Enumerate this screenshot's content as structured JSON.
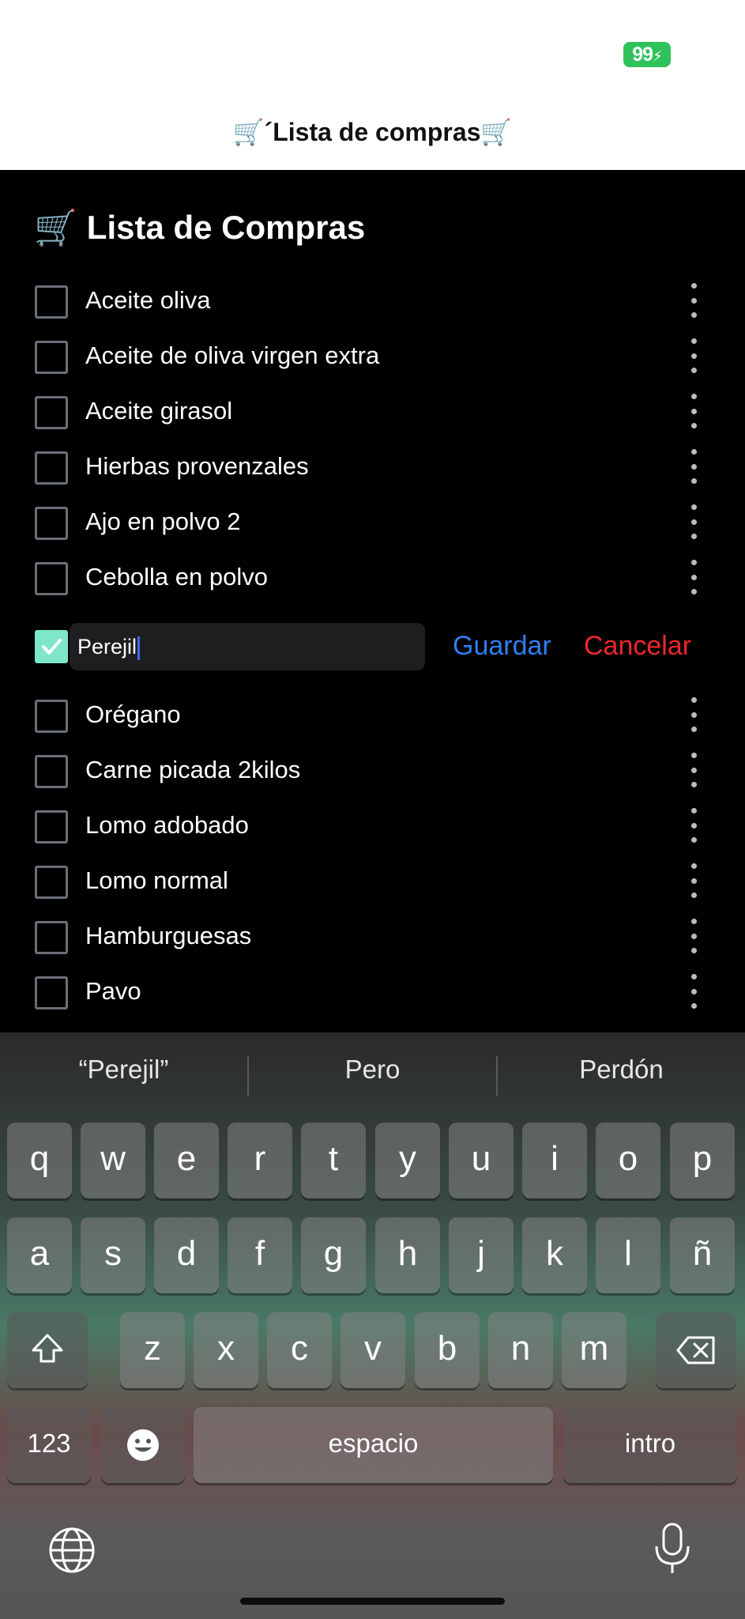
{
  "status_bar": {
    "battery": "99"
  },
  "page_title": "🛒´Lista de compras🛒",
  "header": {
    "cart_icon": "🛒",
    "title": "Lista de Compras"
  },
  "items": [
    {
      "label": "Aceite oliva"
    },
    {
      "label": "Aceite de oliva virgen extra"
    },
    {
      "label": "Aceite girasol"
    },
    {
      "label": "Hierbas provenzales"
    },
    {
      "label": "Ajo en polvo 2"
    },
    {
      "label": "Cebolla en polvo"
    },
    {
      "label": "Orégano"
    },
    {
      "label": "Carne picada 2kilos"
    },
    {
      "label": "Lomo adobado"
    },
    {
      "label": "Lomo normal"
    },
    {
      "label": "Hamburguesas"
    },
    {
      "label": "Pavo"
    }
  ],
  "edit": {
    "value": "Perejil",
    "checked": true,
    "save_label": "Guardar",
    "cancel_label": "Cancelar"
  },
  "keyboard": {
    "suggestions": [
      "“Perejil”",
      "Pero",
      "Perdón"
    ],
    "row1": [
      "q",
      "w",
      "e",
      "r",
      "t",
      "y",
      "u",
      "i",
      "o",
      "p"
    ],
    "row2": [
      "a",
      "s",
      "d",
      "f",
      "g",
      "h",
      "j",
      "k",
      "l",
      "ñ"
    ],
    "row3": [
      "z",
      "x",
      "c",
      "v",
      "b",
      "n",
      "m"
    ],
    "numbers_label": "123",
    "space_label": "espacio",
    "return_label": "intro"
  },
  "colors": {
    "accent_blue": "#2f7ff5",
    "cancel_red": "#f0262b",
    "checkbox_checked": "#7ee6c9",
    "battery_green": "#2fc25b"
  }
}
